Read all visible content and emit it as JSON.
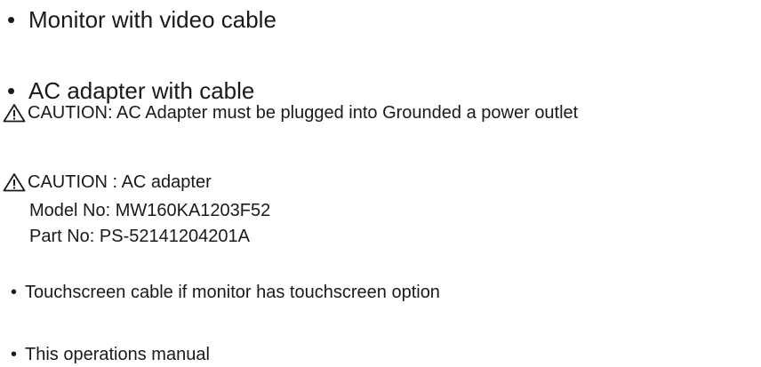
{
  "items": {
    "monitor": "Monitor with video cable",
    "adapter": "AC adapter with cable",
    "caution1": "CAUTION: AC Adapter must be plugged into Grounded a power outlet",
    "caution2": {
      "title": "CAUTION : AC adapter",
      "model": "Model No: MW160KA1203F52",
      "part": "Part No: PS-52141204201A"
    },
    "touchscreen": "Touchscreen cable if monitor has touchscreen option",
    "manual": "This operations manual"
  },
  "bullet": "•",
  "icons": {
    "caution": "warning-triangle-icon"
  }
}
